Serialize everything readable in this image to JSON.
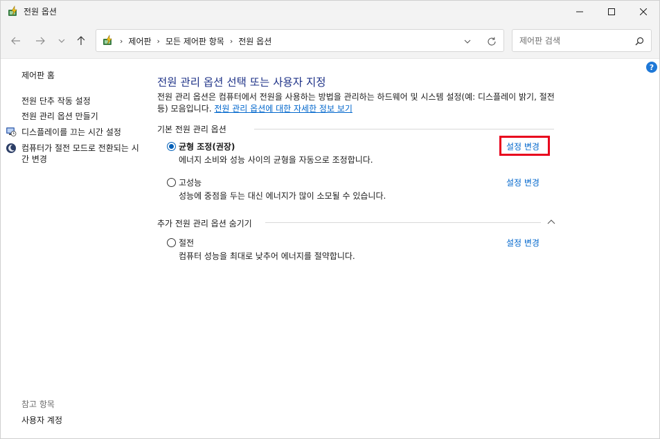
{
  "window": {
    "title": "전원 옵션",
    "colors": {
      "titlebar": "#f3f3f3",
      "link": "#0066cc",
      "heading": "#1e3287",
      "highlight": "#e8001c",
      "radio": "#005fb8"
    }
  },
  "nav": {
    "icons": [
      "arrow-left-icon",
      "arrow-right-icon",
      "chevron-down-icon",
      "arrow-up-icon"
    ],
    "breadcrumb": [
      "제어판",
      "모든 제어판 항목",
      "전원 옵션"
    ],
    "search_placeholder": "제어판 검색"
  },
  "sidebar": {
    "home": "제어판 홈",
    "items": [
      {
        "label": "전원 단추 작동 설정"
      },
      {
        "label": "전원 관리 옵션 만들기"
      },
      {
        "label": "디스플레이를 끄는 시간 설정",
        "icon": "monitor-clock-icon"
      },
      {
        "label": "컴퓨터가 절전 모드로 전환되는 시간 변경",
        "icon": "moon-icon"
      }
    ],
    "see_also_title": "참고 항목",
    "see_also": [
      {
        "label": "사용자 계정"
      }
    ]
  },
  "main": {
    "title": "전원 관리 옵션 선택 또는 사용자 지정",
    "description": "전원 관리 옵션은 컴퓨터에서 전원을 사용하는 방법을 관리하는 하드웨어 및 시스템 설정(예: 디스플레이 밝기, 절전 등) 모음입니다. ",
    "description_link": "전원 관리 옵션에 대한 자세한 정보 보기",
    "basic_group": "기본 전원 관리 옵션",
    "extra_group": "추가 전원 관리 옵션 숨기기",
    "plans": [
      {
        "name": "균형 조정(권장)",
        "desc": "에너지 소비와 성능 사이의 균형을 자동으로 조정합니다.",
        "change": "설정 변경",
        "selected": true
      },
      {
        "name": "고성능",
        "desc": "성능에 중점을 두는 대신 에너지가 많이 소모될 수 있습니다.",
        "change": "설정 변경",
        "selected": false
      },
      {
        "name": "절전",
        "desc": "컴퓨터 성능을 최대로 낮추어 에너지를 절약합니다.",
        "change": "설정 변경",
        "selected": false
      }
    ]
  }
}
